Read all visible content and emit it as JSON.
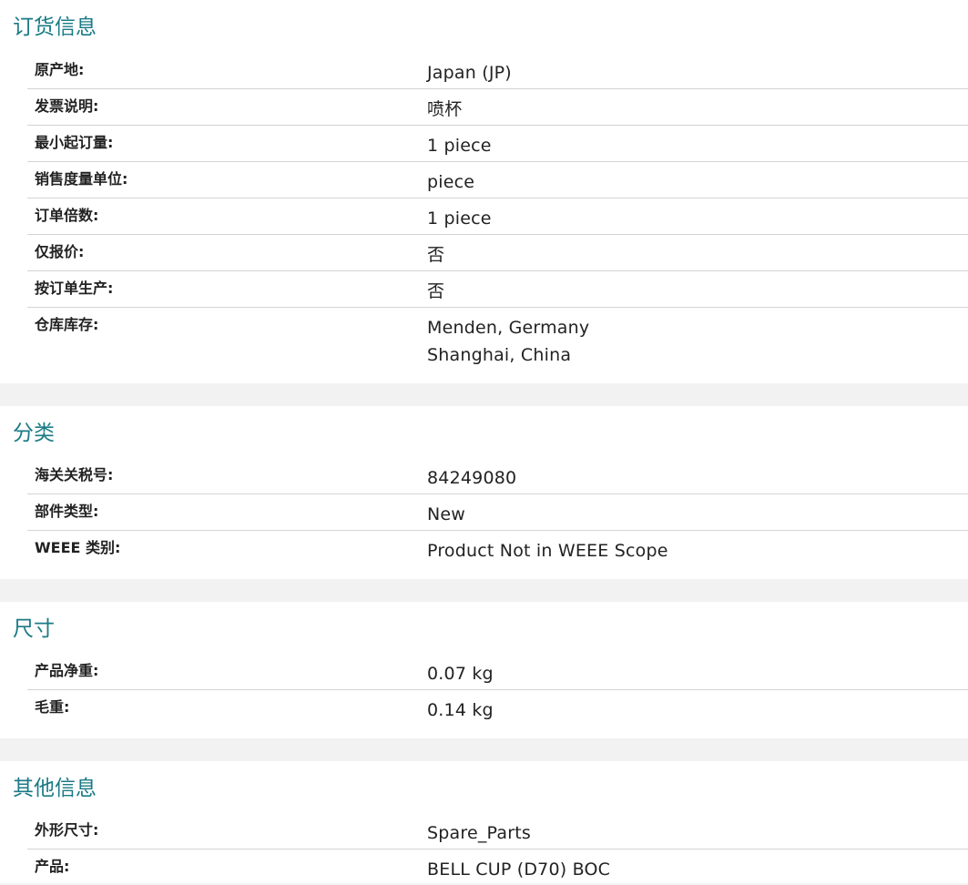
{
  "sections": {
    "ordering": {
      "title": "订货信息",
      "rows": [
        {
          "label": "原产地:",
          "value": "Japan (JP)"
        },
        {
          "label": "发票说明:",
          "value": "喷杯"
        },
        {
          "label": "最小起订量:",
          "value": "1 piece"
        },
        {
          "label": "销售度量单位:",
          "value": "piece"
        },
        {
          "label": "订单倍数:",
          "value": "1 piece"
        },
        {
          "label": "仅报价:",
          "value": "否"
        },
        {
          "label": "按订单生产:",
          "value": "否"
        },
        {
          "label": "仓库库存:",
          "values": [
            "Menden, Germany",
            "Shanghai, China"
          ]
        }
      ]
    },
    "classification": {
      "title": "分类",
      "rows": [
        {
          "label": "海关关税号:",
          "value": "84249080"
        },
        {
          "label": "部件类型:",
          "value": "New"
        },
        {
          "label": "WEEE 类别:",
          "value": "Product Not in WEEE Scope"
        }
      ]
    },
    "dimensions": {
      "title": "尺寸",
      "rows": [
        {
          "label": "产品净重:",
          "value": "0.07 kg"
        },
        {
          "label": "毛重:",
          "value": "0.14 kg"
        }
      ]
    },
    "other": {
      "title": "其他信息",
      "rows": [
        {
          "label": "外形尺寸:",
          "value": "Spare_Parts"
        },
        {
          "label": "产品:",
          "value": "BELL CUP (D70) BOC"
        }
      ]
    }
  },
  "colors": {
    "section_title": "#1a7a86",
    "divider": "#d4d4d4",
    "page_background": "#f2f2f2"
  }
}
